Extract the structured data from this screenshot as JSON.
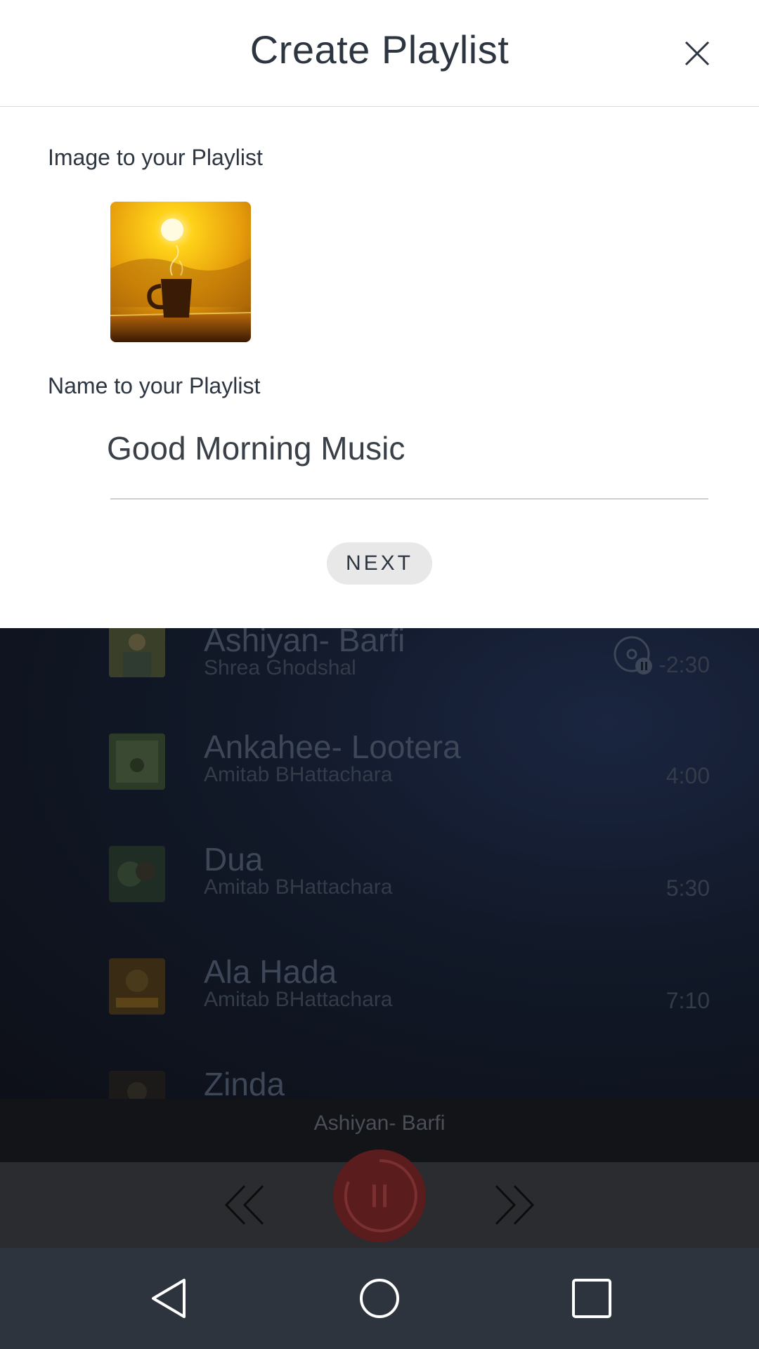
{
  "modal": {
    "title": "Create Playlist",
    "image_label": "Image to your Playlist",
    "name_label": "Name to your Playlist",
    "name_value": "Good Morning Music",
    "next_label": "NEXT",
    "close_icon": "close-icon",
    "image_icon": "coffee-sunrise-image"
  },
  "songs": [
    {
      "title": "Ashiyan- Barfi",
      "artist": "Shrea Ghodshal",
      "time": "-2:30",
      "playing": true
    },
    {
      "title": "Ankahee- Lootera",
      "artist": "Amitab BHattachara",
      "time": "4:00"
    },
    {
      "title": "Dua",
      "artist": "Amitab BHattachara",
      "time": "5:30"
    },
    {
      "title": "Ala Hada",
      "artist": "Amitab BHattachara",
      "time": "7:10"
    },
    {
      "title": "Zinda",
      "artist": "",
      "time": ""
    }
  ],
  "now_playing": {
    "title": "Ashiyan- Barfi"
  },
  "controls": {
    "prev_icon": "double-chevron-left-icon",
    "play_pause_icon": "pause-icon",
    "next_icon": "double-chevron-right-icon"
  },
  "nav": {
    "back_icon": "back-triangle-icon",
    "home_icon": "home-circle-icon",
    "recents_icon": "recents-square-icon"
  },
  "colors": {
    "accent_play": "#d93a3a",
    "nav_bg": "#2e343d",
    "modal_bg": "#ffffff"
  }
}
